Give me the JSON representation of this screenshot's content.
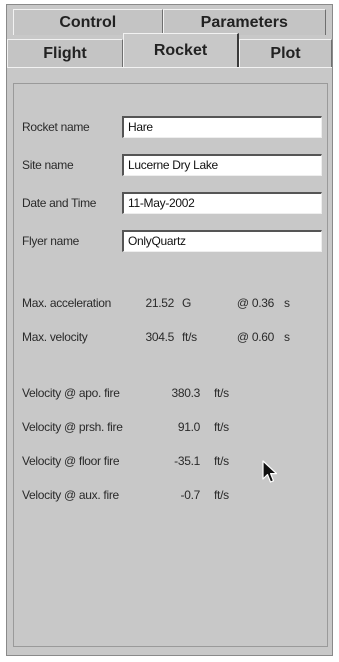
{
  "tabs": {
    "back_row": [
      {
        "label": "Control"
      },
      {
        "label": "Parameters"
      }
    ],
    "front_row": [
      {
        "label": "Flight"
      },
      {
        "label": "Rocket",
        "active": true
      },
      {
        "label": "Plot"
      }
    ]
  },
  "fields": [
    {
      "label": "Rocket name",
      "value": "Hare"
    },
    {
      "label": "Site name",
      "value": "Lucerne Dry Lake"
    },
    {
      "label": "Date and Time",
      "value": "11-May-2002"
    },
    {
      "label": "Flyer name",
      "value": "OnlyQuartz"
    }
  ],
  "stats": [
    {
      "label": "Max. acceleration",
      "value": "21.52",
      "unit": "G",
      "at": "@ 0.36",
      "at_unit": "s"
    },
    {
      "label": "Max. velocity",
      "value": "304.5",
      "unit": "ft/s",
      "at": "@ 0.60",
      "at_unit": "s"
    }
  ],
  "velocities": [
    {
      "label": "Velocity @ apo. fire",
      "value": "380.3",
      "unit": "ft/s"
    },
    {
      "label": "Velocity @ prsh. fire",
      "value": "91.0",
      "unit": "ft/s"
    },
    {
      "label": "Velocity @ floor fire",
      "value": "-35.1",
      "unit": "ft/s"
    },
    {
      "label": "Velocity @ aux. fire",
      "value": "-0.7",
      "unit": "ft/s"
    }
  ],
  "icons": {
    "cursor": "mouse-pointer-icon"
  }
}
